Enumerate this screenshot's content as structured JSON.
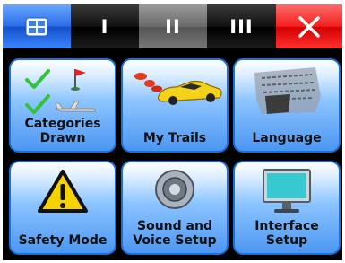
{
  "topbar": {
    "tabs": [
      {
        "name": "home",
        "label": "",
        "icon": "grid-icon"
      },
      {
        "name": "page-1",
        "label": "I"
      },
      {
        "name": "page-2",
        "label": "II",
        "selected": true
      },
      {
        "name": "page-3",
        "label": "III"
      },
      {
        "name": "close",
        "label": "",
        "icon": "close-icon"
      }
    ]
  },
  "tiles": [
    {
      "label": "Categories Drawn",
      "icon": "checkmarks-flag-plane-icon"
    },
    {
      "label": "My Trails",
      "icon": "car-trail-icon"
    },
    {
      "label": "Language",
      "icon": "rosetta-stone-icon"
    },
    {
      "label": "Safety Mode",
      "icon": "warning-sign-icon"
    },
    {
      "label": "Sound and Voice Setup",
      "icon": "speaker-icon"
    },
    {
      "label": "Interface Setup",
      "icon": "monitor-icon"
    }
  ],
  "colors": {
    "tile_border": "#1a6fd8",
    "home_tab": "#2c6fe8",
    "close_tab": "#e60000"
  }
}
